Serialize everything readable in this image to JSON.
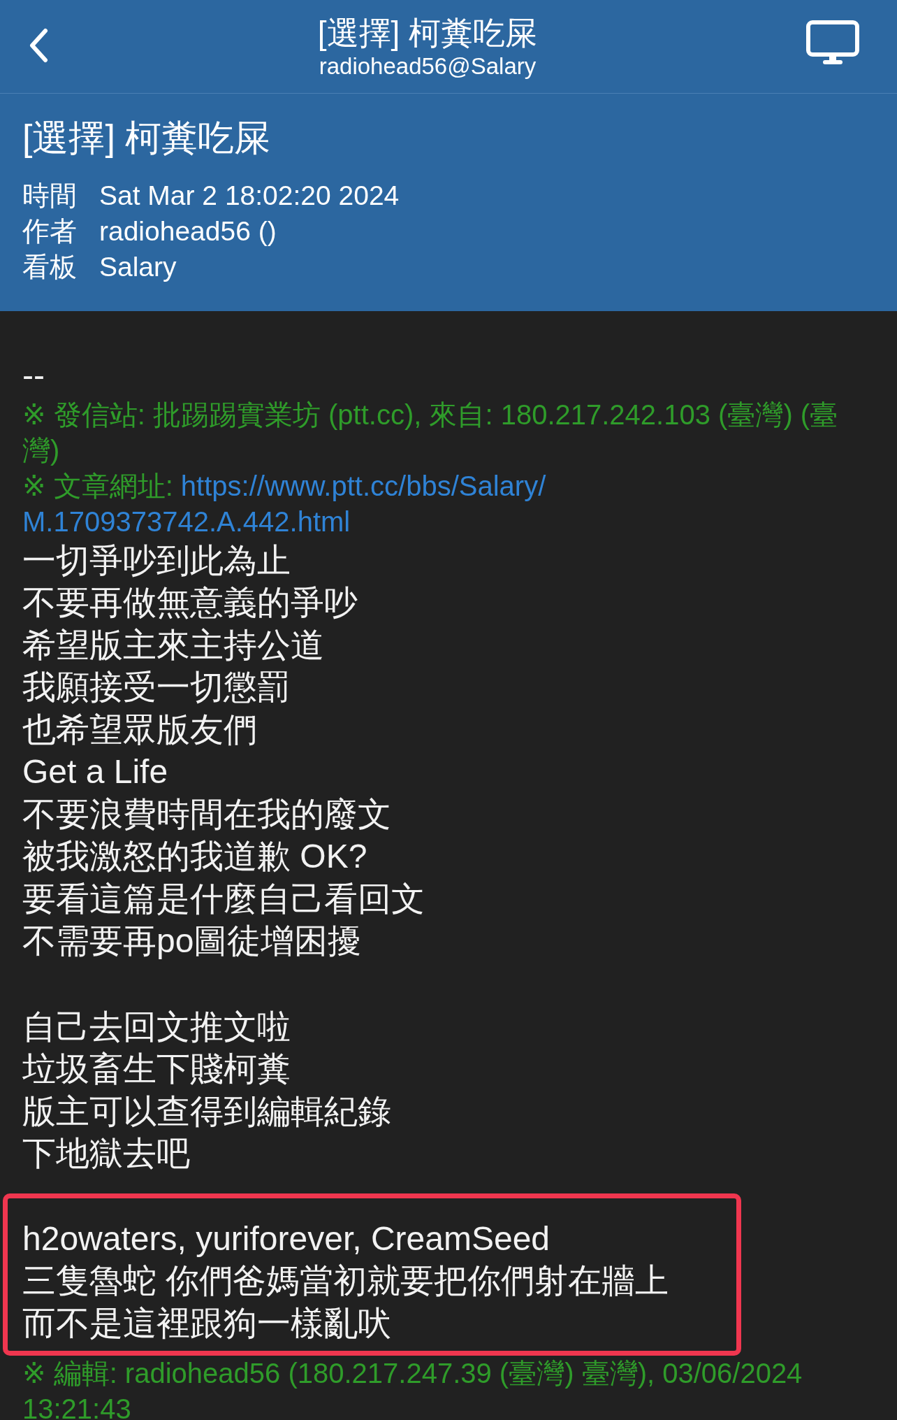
{
  "nav": {
    "title": "[選擇] 柯糞吃屎",
    "subtitle": "radiohead56@Salary"
  },
  "header": {
    "title": "[選擇] 柯糞吃屎",
    "meta": [
      {
        "label": "時間",
        "value": "Sat Mar  2 18:02:20 2024"
      },
      {
        "label": "作者",
        "value": "radiohead56 ()"
      },
      {
        "label": "看板",
        "value": "Salary"
      }
    ]
  },
  "body": [
    {
      "kind": "blank"
    },
    {
      "kind": "text",
      "text": "--"
    },
    {
      "kind": "meta",
      "text": "※ 發信站: 批踢踢實業坊 (ptt.cc), 來自: 180.217.242.103 (臺灣) (臺灣)"
    },
    {
      "kind": "url",
      "label": "※ 文章網址: ",
      "parts": [
        "https://www.ptt.cc/bbs/Salary/",
        "M.1709373742.A.442.html"
      ]
    },
    {
      "kind": "text",
      "text": "一切爭吵到此為止"
    },
    {
      "kind": "text",
      "text": "不要再做無意義的爭吵"
    },
    {
      "kind": "text",
      "text": "希望版主來主持公道"
    },
    {
      "kind": "text",
      "text": "我願接受一切懲罰"
    },
    {
      "kind": "text",
      "text": "也希望眾版友們"
    },
    {
      "kind": "text",
      "text": "Get a Life"
    },
    {
      "kind": "text",
      "text": "不要浪費時間在我的廢文"
    },
    {
      "kind": "text",
      "text": "被我激怒的我道歉 OK?"
    },
    {
      "kind": "text",
      "text": "要看這篇是什麼自己看回文"
    },
    {
      "kind": "text",
      "text": "不需要再po圖徒增困擾"
    },
    {
      "kind": "blank"
    },
    {
      "kind": "text",
      "text": "自己去回文推文啦"
    },
    {
      "kind": "text",
      "text": "垃圾畜生下賤柯糞"
    },
    {
      "kind": "text",
      "text": "版主可以查得到編輯紀錄"
    },
    {
      "kind": "text",
      "text": "下地獄去吧"
    },
    {
      "kind": "highlight",
      "lines": [
        "h2owaters, yuriforever, CreamSeed",
        "三隻魯蛇 你們爸媽當初就要把你們射在牆上",
        "而不是這裡跟狗一樣亂吠"
      ]
    },
    {
      "kind": "meta",
      "text": "※ 編輯: radiohead56 (180.217.247.39 (臺灣) 臺灣), 03/06/2024 13:21:43"
    }
  ]
}
